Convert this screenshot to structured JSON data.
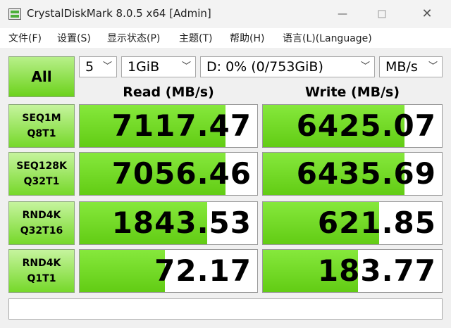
{
  "window": {
    "title": "CrystalDiskMark 8.0.5 x64 [Admin]"
  },
  "menu": [
    "文件(F)",
    "设置(S)",
    "显示状态(P)",
    "主题(T)",
    "帮助(H)",
    "语言(L)(Language)"
  ],
  "controls": {
    "all_label": "All",
    "count": "5",
    "size": "1GiB",
    "drive": "D: 0% (0/753GiB)",
    "unit": "MB/s"
  },
  "headers": {
    "read": "Read (MB/s)",
    "write": "Write (MB/s)"
  },
  "tests": [
    {
      "line1": "SEQ1M",
      "line2": "Q8T1",
      "read": "7117.47",
      "write": "6425.07",
      "read_fill": 0.82,
      "write_fill": 0.79
    },
    {
      "line1": "SEQ128K",
      "line2": "Q32T1",
      "read": "7056.46",
      "write": "6435.69",
      "read_fill": 0.82,
      "write_fill": 0.79
    },
    {
      "line1": "RND4K",
      "line2": "Q32T16",
      "read": "1843.53",
      "write": "621.85",
      "read_fill": 0.72,
      "write_fill": 0.65
    },
    {
      "line1": "RND4K",
      "line2": "Q1T1",
      "read": "72.17",
      "write": "183.77",
      "read_fill": 0.48,
      "write_fill": 0.53
    }
  ],
  "status_text": "",
  "colors": {
    "accent_green": "#6cd21c",
    "bar_green": "#7ee032"
  },
  "icons": {
    "app": "crystaldiskmark-icon",
    "minimize": "minimize-icon",
    "maximize": "maximize-icon",
    "close": "close-icon",
    "dropdown": "chevron-down-icon"
  }
}
